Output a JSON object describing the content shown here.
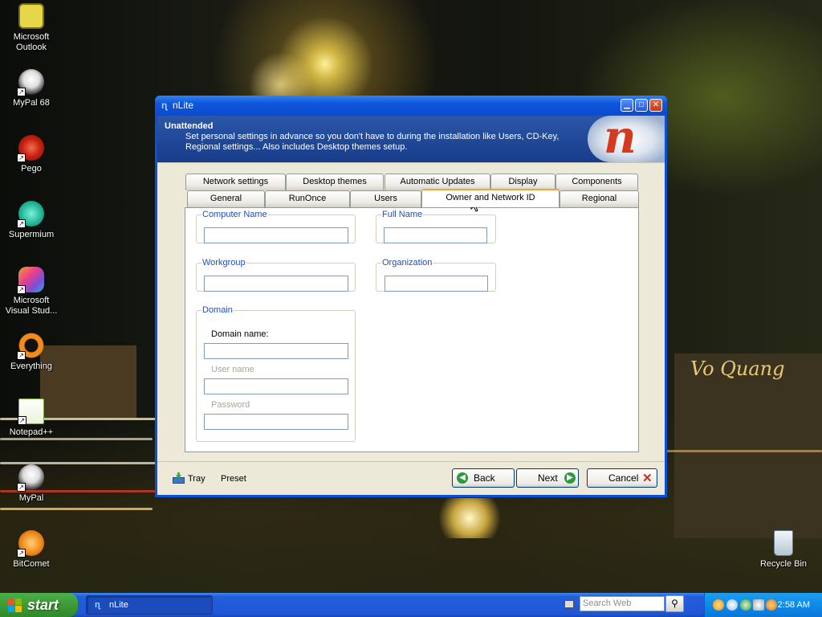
{
  "desktop": {
    "icons": [
      {
        "label": "Microsoft\nOutlook",
        "icon": "outlook-icon"
      },
      {
        "label": "MyPal 68",
        "icon": "mypal-icon"
      },
      {
        "label": "Pego",
        "icon": "pego-icon"
      },
      {
        "label": "Supermium",
        "icon": "supermium-icon"
      },
      {
        "label": "Microsoft\nVisual Stud...",
        "icon": "visual-studio-icon"
      },
      {
        "label": "Everything",
        "icon": "everything-icon"
      },
      {
        "label": "Notepad++",
        "icon": "notepadpp-icon"
      },
      {
        "label": "MyPal",
        "icon": "mypal-icon"
      },
      {
        "label": "BitComet",
        "icon": "bitcomet-icon"
      },
      {
        "label": "Recycle Bin",
        "icon": "recycle-bin-icon"
      }
    ],
    "wallpaper_sign": "Vo Quang"
  },
  "window": {
    "title": "nLite",
    "header": {
      "title": "Unattended",
      "description": "Set personal settings in advance so you don't have to during the installation like Users, CD-Key, Regional settings... Also includes Desktop themes setup."
    },
    "tabs_row1": [
      "Network settings",
      "Desktop themes",
      "Automatic Updates",
      "Display",
      "Components"
    ],
    "tabs_row2": [
      "General",
      "RunOnce",
      "Users",
      "Owner and Network ID",
      "Regional"
    ],
    "active_tab": "Owner and Network ID",
    "groups": {
      "computer_name": {
        "legend": "Computer Name",
        "value": ""
      },
      "full_name": {
        "legend": "Full Name",
        "value": ""
      },
      "workgroup": {
        "legend": "Workgroup",
        "value": ""
      },
      "organization": {
        "legend": "Organization",
        "value": ""
      },
      "domain": {
        "legend": "Domain",
        "domain_name_label": "Domain name:",
        "user_name_label": "User name",
        "password_label": "Password",
        "domain_name_value": "",
        "user_name_value": "",
        "password_value": ""
      }
    },
    "footer": {
      "tray_label": "Tray",
      "preset_label": "Preset",
      "back_label": "Back",
      "next_label": "Next",
      "cancel_label": "Cancel"
    }
  },
  "taskbar": {
    "start_label": "start",
    "task_label": "nLite",
    "search_placeholder": "Search Web",
    "clock": "2:58 AM"
  },
  "colors": {
    "header_blue": "#183d89",
    "tab_highlight": "#f2a33a",
    "legend_blue": "#1f4fb8",
    "taskbar_blue": "#245edb",
    "start_green": "#3d9b37"
  }
}
